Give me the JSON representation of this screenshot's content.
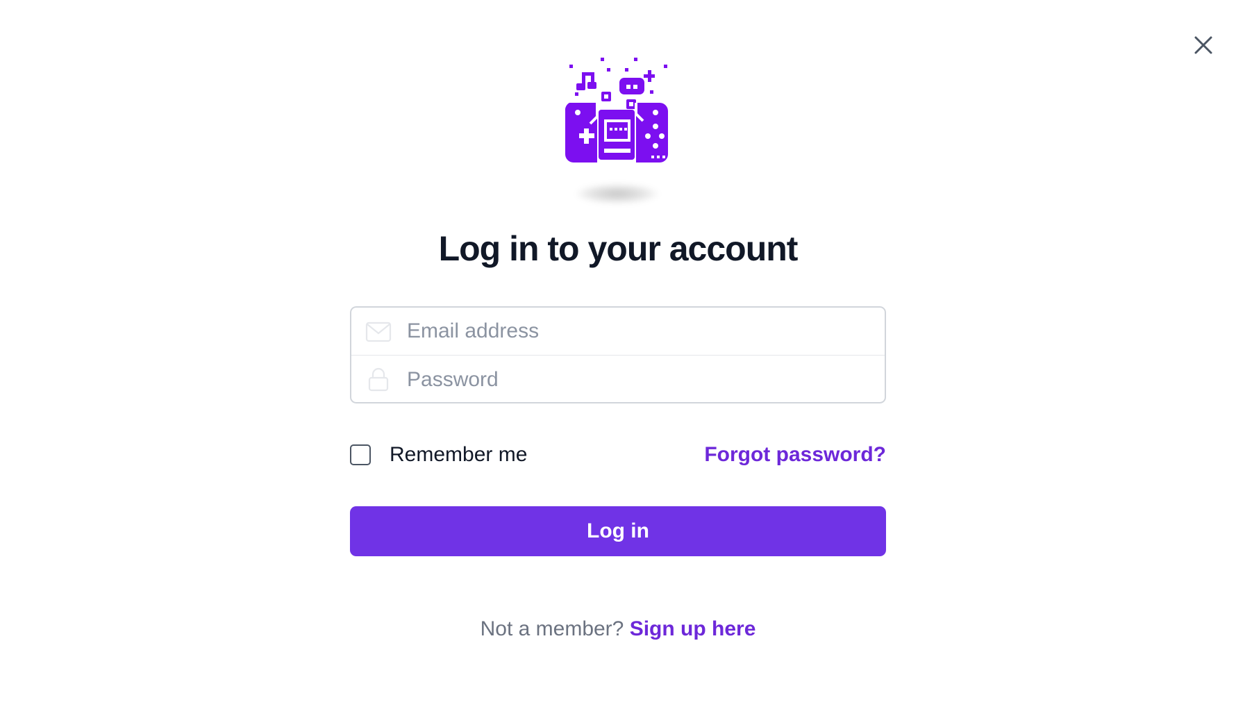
{
  "icons": {
    "close": "close-icon",
    "logo": "game-console-logo",
    "email": "mail-icon",
    "password": "lock-icon"
  },
  "colors": {
    "accent": "#7033e6",
    "link": "#6d28d9",
    "heading": "#111827",
    "muted": "#6b7280",
    "placeholder": "#8b93a1"
  },
  "login": {
    "title": "Log in to your account",
    "email_placeholder": "Email address",
    "email_value": "",
    "password_placeholder": "Password",
    "password_value": "",
    "remember_label": "Remember me",
    "remember_checked": false,
    "forgot_label": "Forgot password?",
    "submit_label": "Log in"
  },
  "footer": {
    "prompt": "Not a member?",
    "signup_label": "Sign up here"
  }
}
